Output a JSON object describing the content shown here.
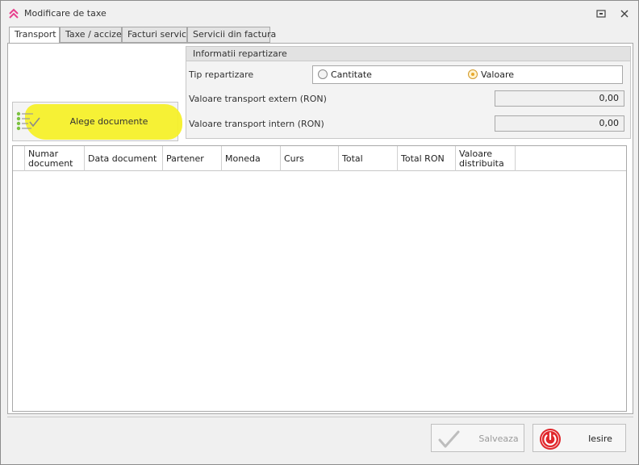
{
  "window": {
    "title": "Modificare de taxe",
    "accent_color": "#e83e8c"
  },
  "tabs": [
    {
      "label": "Transport",
      "active": true
    },
    {
      "label": "Taxe / accize",
      "active": false
    },
    {
      "label": "Facturi servicii",
      "active": false
    },
    {
      "label": "Servicii din factura",
      "active": false
    }
  ],
  "repartition": {
    "group_title": "Informatii repartizare",
    "tip_label": "Tip repartizare",
    "options": [
      {
        "label": "Cantitate",
        "selected": false
      },
      {
        "label": "Valoare",
        "selected": true
      }
    ],
    "extern_label": "Valoare transport extern (RON)",
    "extern_value": "0,00",
    "intern_label": "Valoare transport intern (RON)",
    "intern_value": "0,00"
  },
  "choose_button": {
    "label": "Alege documente",
    "highlight_color": "#f6f02a"
  },
  "grid": {
    "columns": [
      "Numar document",
      "Data document",
      "Partener",
      "Moneda",
      "Curs",
      "Total",
      "Total RON",
      "Valoare distribuita"
    ],
    "rows": []
  },
  "footer": {
    "save_label": "Salveaza",
    "save_enabled": false,
    "exit_label": "Iesire",
    "exit_color": "#e0262b"
  }
}
